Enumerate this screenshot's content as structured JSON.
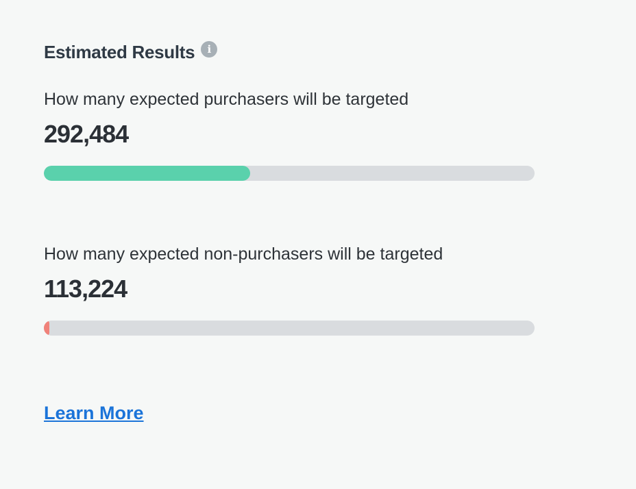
{
  "card": {
    "title": "Estimated Results",
    "info_icon": "info-circle-icon"
  },
  "metrics": [
    {
      "label": "How many expected purchasers will be targeted",
      "value": "292,484",
      "progress_fraction": 0.42,
      "color": "#5ad1ac"
    },
    {
      "label": "How many expected non-purchasers will be targeted",
      "value": "113,224",
      "progress_fraction": 0.011,
      "color": "#f0827a"
    }
  ],
  "learn_more_label": "Learn More",
  "colors": {
    "background": "#f6f8f7",
    "track": "#d9dcdf",
    "link": "#1b74d9"
  }
}
